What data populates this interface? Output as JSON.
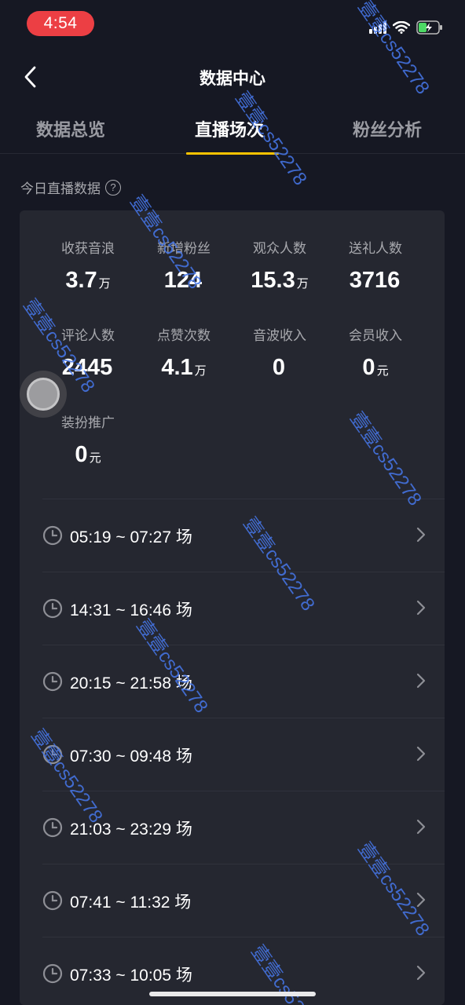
{
  "status_bar": {
    "time": "4:54"
  },
  "nav": {
    "title": "数据中心"
  },
  "tabs": [
    {
      "label": "数据总览",
      "active": false
    },
    {
      "label": "直播场次",
      "active": true
    },
    {
      "label": "粉丝分析",
      "active": false
    }
  ],
  "section": {
    "title": "今日直播数据",
    "help": "?"
  },
  "stats": [
    {
      "label": "收获音浪",
      "value": "3.7",
      "unit": "万"
    },
    {
      "label": "新增粉丝",
      "value": "124",
      "unit": ""
    },
    {
      "label": "观众人数",
      "value": "15.3",
      "unit": "万"
    },
    {
      "label": "送礼人数",
      "value": "3716",
      "unit": ""
    },
    {
      "label": "评论人数",
      "value": "2445",
      "unit": ""
    },
    {
      "label": "点赞次数",
      "value": "4.1",
      "unit": "万"
    },
    {
      "label": "音波收入",
      "value": "0",
      "unit": ""
    },
    {
      "label": "会员收入",
      "value": "0",
      "unit": "元"
    },
    {
      "label": "装扮推广",
      "value": "0",
      "unit": "元"
    }
  ],
  "sessions": [
    {
      "range": "05:19 ~ 07:27 场"
    },
    {
      "range": "14:31 ~ 16:46 场"
    },
    {
      "range": "20:15 ~ 21:58 场"
    },
    {
      "range": "07:30 ~ 09:48 场"
    },
    {
      "range": "21:03 ~ 23:29 场"
    },
    {
      "range": "07:41 ~ 11:32 场"
    },
    {
      "range": "07:33 ~ 10:05 场"
    }
  ],
  "watermark": "壹壹cs52278",
  "colors": {
    "accent": "#fdc300",
    "background": "#161823",
    "card": "#252730",
    "time_pill": "#ec3f44",
    "watermark": "#4678eb"
  }
}
